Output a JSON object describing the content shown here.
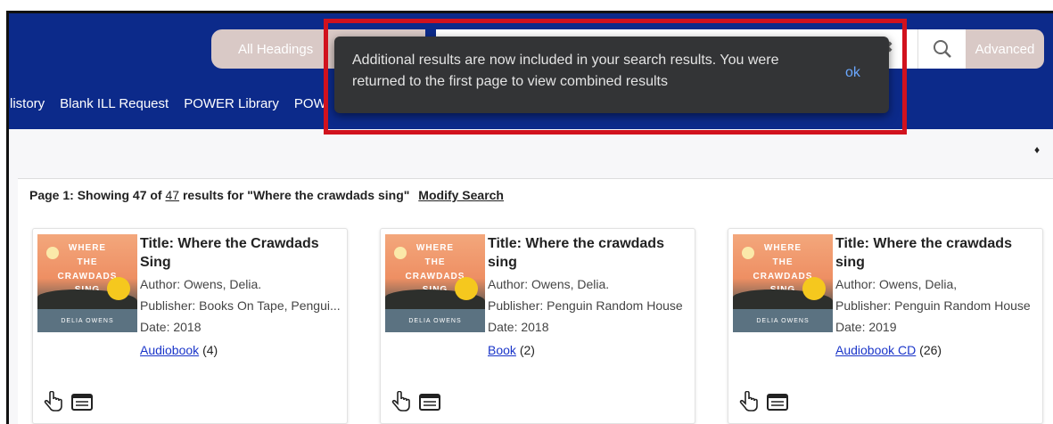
{
  "search": {
    "heading_select": "All Headings",
    "query": "Where the crawdads sing",
    "advanced_label": "Advanced"
  },
  "nav": {
    "items": [
      "listory",
      "Blank ILL Request",
      "POWER Library",
      "POW"
    ]
  },
  "toast": {
    "message": "Additional results are now included in your search results. You were returned to the first page to view combined results",
    "ok_label": "ok"
  },
  "results": {
    "summary_prefix": "Page 1: Showing 47 of",
    "total": "47",
    "summary_suffix": "results for \"Where the crawdads sing\"",
    "modify_label": "Modify Search"
  },
  "cards": [
    {
      "title_1": "Title: Where the Crawdads",
      "title_2": "Sing",
      "author": "Author: Owens, Delia.",
      "publisher": "Publisher: Books On Tape, Pengui...",
      "date": "Date: 2018",
      "format_label": "Audiobook",
      "format_count": "(4)"
    },
    {
      "title_1": "Title: Where the crawdads",
      "title_2": "sing",
      "author": "Author: Owens, Delia.",
      "publisher": "Publisher: Penguin Random House",
      "date": "Date: 2018",
      "format_label": "Book",
      "format_count": "(2)"
    },
    {
      "title_1": "Title: Where the crawdads",
      "title_2": "sing",
      "author": "Author: Owens, Delia,",
      "publisher": "Publisher: Penguin Random House",
      "date": "Date: 2019",
      "format_label": "Audiobook CD",
      "format_count": "(26)"
    }
  ],
  "colors": {
    "header": "#0c2a8a",
    "highlight_border": "#d1121e",
    "toast_bg": "#333436",
    "link": "#1a35c9"
  }
}
